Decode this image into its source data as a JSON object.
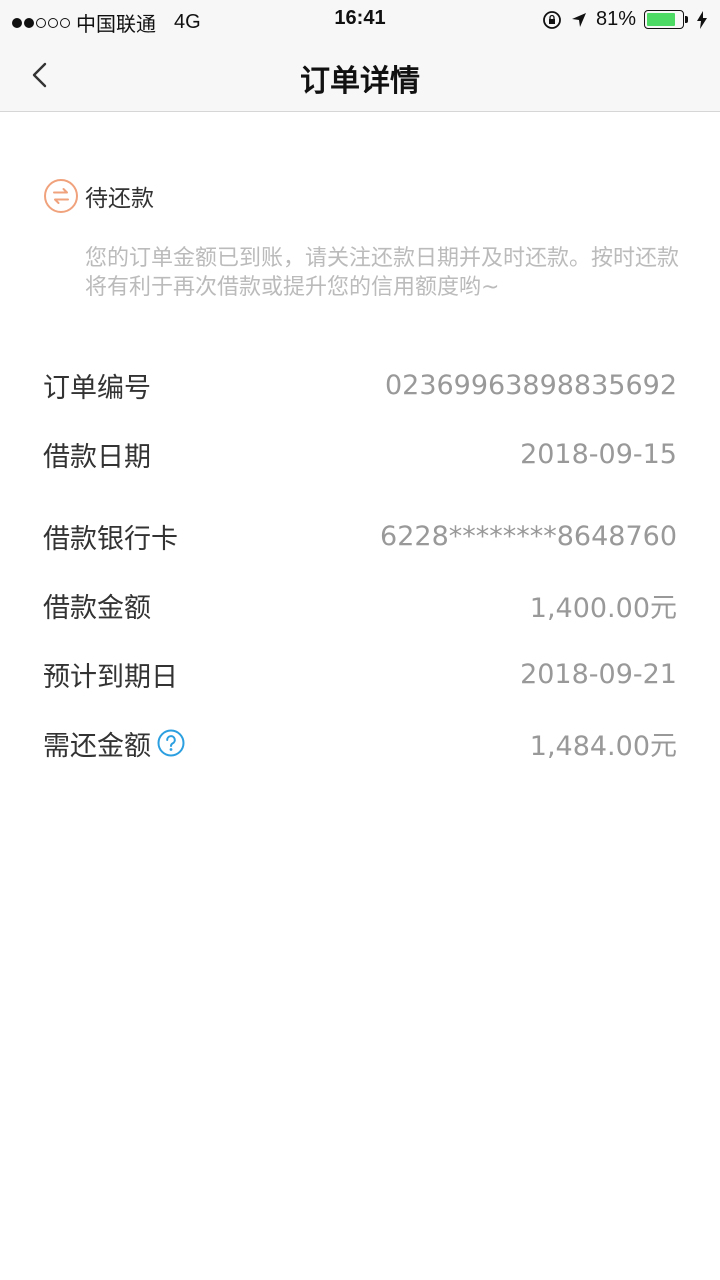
{
  "status_bar": {
    "carrier": "中国联通",
    "network": "4G",
    "time": "16:41",
    "battery_text": "81%",
    "battery_level": 0.81,
    "battery_color": "#4cd964"
  },
  "nav": {
    "title": "订单详情",
    "back_icon": "chevron-left-icon"
  },
  "order_status": {
    "label": "待还款",
    "icon": "exchange-arrows-icon",
    "icon_color": "#f0a27c",
    "notice": "您的订单金额已到账，请关注还款日期并及时还款。按时还款将有利于再次借款或提升您的信用额度哟~"
  },
  "details": [
    {
      "label": "订单编号",
      "value": "02369963898835692"
    },
    {
      "label": "借款日期",
      "value": "2018-09-15"
    },
    {
      "label": "借款银行卡",
      "value": "6228********8648760"
    },
    {
      "label": "借款金额",
      "value": "1,400.00元"
    },
    {
      "label": "预计到期日",
      "value": "2018-09-21"
    },
    {
      "label": "需还金额",
      "value": "1,484.00元",
      "help_icon": "question-circle-icon",
      "help_color": "#2b9fe0"
    }
  ]
}
